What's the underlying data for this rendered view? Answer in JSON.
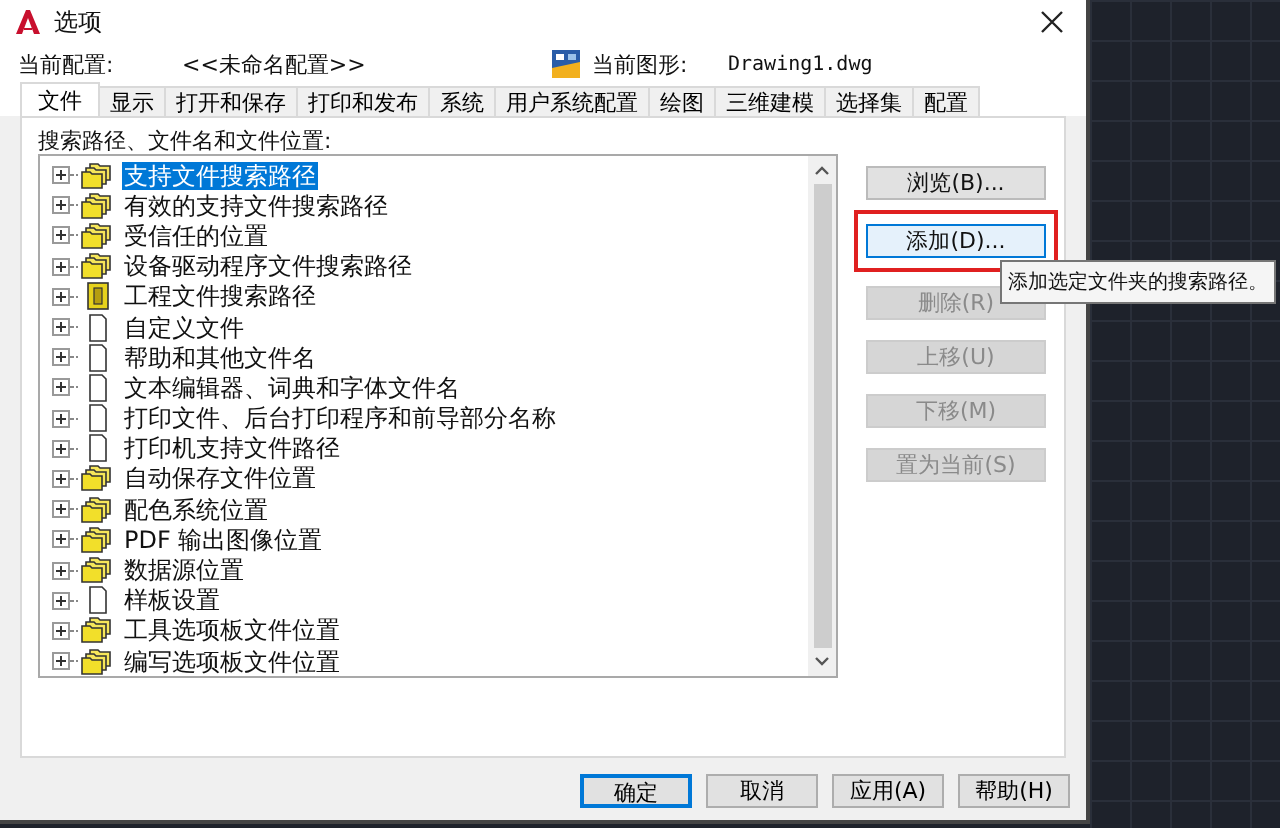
{
  "window": {
    "title": "选项"
  },
  "header": {
    "profile_label": "当前配置:",
    "profile_value": "<<未命名配置>>",
    "drawing_label": "当前图形:",
    "drawing_value": "Drawing1.dwg"
  },
  "tabs": [
    {
      "label": "文件",
      "selected": true
    },
    {
      "label": "显示",
      "selected": false
    },
    {
      "label": "打开和保存",
      "selected": false
    },
    {
      "label": "打印和发布",
      "selected": false
    },
    {
      "label": "系统",
      "selected": false
    },
    {
      "label": "用户系统配置",
      "selected": false
    },
    {
      "label": "绘图",
      "selected": false
    },
    {
      "label": "三维建模",
      "selected": false
    },
    {
      "label": "选择集",
      "selected": false
    },
    {
      "label": "配置",
      "selected": false
    }
  ],
  "tree": {
    "label": "搜索路径、文件名和文件位置:",
    "items": [
      {
        "label": "支持文件搜索路径",
        "kind": "folders",
        "expanded": false,
        "selected": true
      },
      {
        "label": "有效的支持文件搜索路径",
        "kind": "folders",
        "expanded": false,
        "selected": false
      },
      {
        "label": "受信任的位置",
        "kind": "folders",
        "expanded": false,
        "selected": false
      },
      {
        "label": "设备驱动程序文件搜索路径",
        "kind": "folders",
        "expanded": false,
        "selected": false
      },
      {
        "label": "工程文件搜索路径",
        "kind": "project",
        "expanded": false,
        "selected": false
      },
      {
        "label": "自定义文件",
        "kind": "file",
        "expanded": false,
        "selected": false
      },
      {
        "label": "帮助和其他文件名",
        "kind": "file",
        "expanded": false,
        "selected": false
      },
      {
        "label": "文本编辑器、词典和字体文件名",
        "kind": "file",
        "expanded": false,
        "selected": false
      },
      {
        "label": "打印文件、后台打印程序和前导部分名称",
        "kind": "file",
        "expanded": false,
        "selected": false
      },
      {
        "label": "打印机支持文件路径",
        "kind": "file",
        "expanded": false,
        "selected": false
      },
      {
        "label": "自动保存文件位置",
        "kind": "folders",
        "expanded": false,
        "selected": false
      },
      {
        "label": "配色系统位置",
        "kind": "folders",
        "expanded": false,
        "selected": false
      },
      {
        "label": "PDF 输出图像位置",
        "kind": "folders",
        "expanded": false,
        "selected": false
      },
      {
        "label": "数据源位置",
        "kind": "folders",
        "expanded": false,
        "selected": false
      },
      {
        "label": "样板设置",
        "kind": "file",
        "expanded": false,
        "selected": false
      },
      {
        "label": "工具选项板文件位置",
        "kind": "folders",
        "expanded": false,
        "selected": false
      },
      {
        "label": "编写选项板文件位置",
        "kind": "folders",
        "expanded": false,
        "selected": false
      }
    ]
  },
  "side_buttons": [
    {
      "label": "浏览(B)...",
      "disabled": false,
      "focused": false,
      "highlighted": false
    },
    {
      "label": "添加(D)...",
      "disabled": false,
      "focused": true,
      "highlighted": true
    },
    {
      "label": "删除(R)",
      "disabled": true,
      "focused": false,
      "highlighted": false
    },
    {
      "label": "上移(U)",
      "disabled": true,
      "focused": false,
      "highlighted": false
    },
    {
      "label": "下移(M)",
      "disabled": true,
      "focused": false,
      "highlighted": false
    },
    {
      "label": "置为当前(S)",
      "disabled": true,
      "focused": false,
      "highlighted": false
    }
  ],
  "tooltip": "添加选定文件夹的搜索路径。",
  "footer_buttons": [
    {
      "label": "确定",
      "default": true
    },
    {
      "label": "取消",
      "default": false
    },
    {
      "label": "应用(A)",
      "default": false
    },
    {
      "label": "帮助(H)",
      "default": false
    }
  ]
}
